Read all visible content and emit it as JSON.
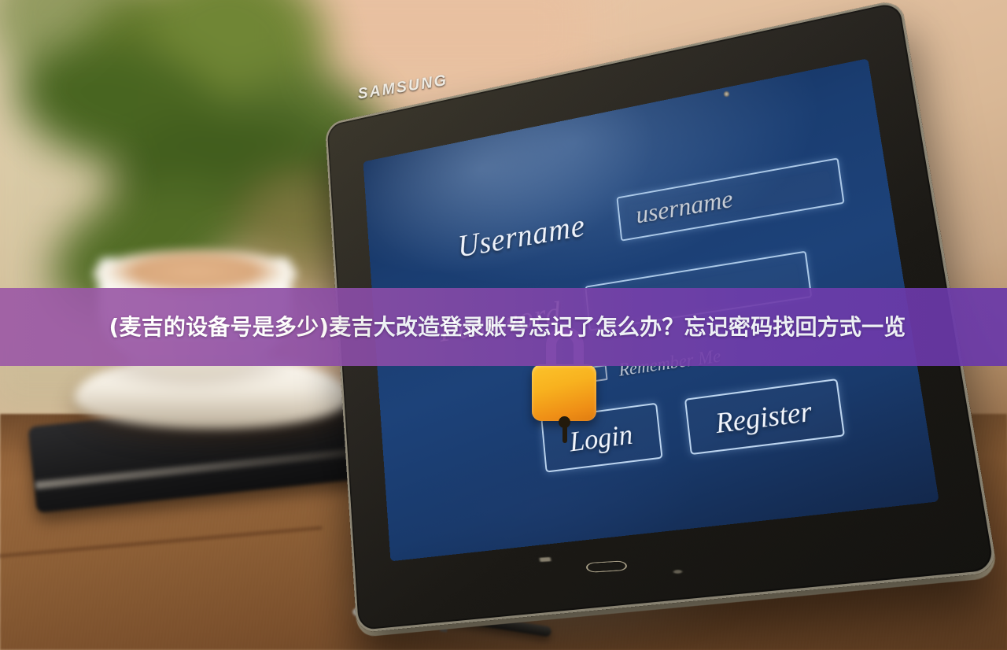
{
  "overlay": {
    "caption": "(麦吉的设备号是多少)麦吉大改造登录账号忘记了怎么办？忘记密码找回方式一览",
    "gradient_from": "#9d5ba7",
    "gradient_to": "#6a39aa",
    "text_color": "#ffffff"
  },
  "device": {
    "brand": "SAMSUNG",
    "screen_color": "#1d4279",
    "bezel_color": "#23201b"
  },
  "login_screen": {
    "username": {
      "label": "Username",
      "placeholder": "username",
      "value": ""
    },
    "password": {
      "label": "Password",
      "placeholder": "",
      "value": ""
    },
    "remember_me": {
      "label": "Remember Me",
      "checked": false
    },
    "buttons": {
      "login": "Login",
      "register": "Register"
    },
    "lock_icon": {
      "name": "padlock-icon",
      "body_color": "#f5a81c",
      "shackle_color": "#b489d6"
    }
  },
  "scene": {
    "surface": "wooden-table",
    "objects": [
      "coffee-cup",
      "saucer",
      "smartphone",
      "stylus",
      "potted-plant"
    ]
  }
}
